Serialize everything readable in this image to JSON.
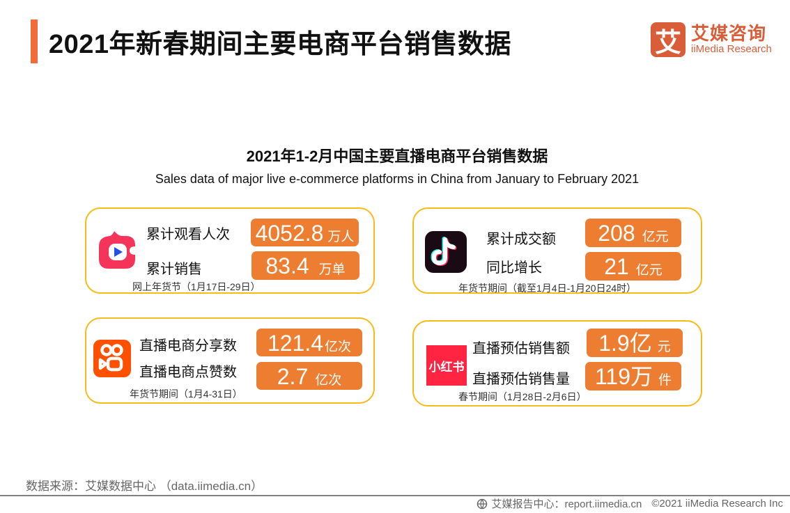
{
  "header": {
    "title": "2021年新春期间主要电商平台销售数据",
    "accent_color": "#f26b3a"
  },
  "logo": {
    "mark": "艾",
    "name_cn": "艾媒咨询",
    "name_en": "iiMedia Research",
    "color": "#d95d39"
  },
  "subtitle": {
    "cn": "2021年1-2月中国主要直播电商平台销售数据",
    "en": "Sales data of major live e-commerce platforms in China from January to February 2021"
  },
  "cards": [
    {
      "platform_icon": "taobao-live-icon",
      "rows": [
        {
          "label": "累计观看人次",
          "value": "4052.8",
          "unit": "万人"
        },
        {
          "label": "累计销售",
          "value": "83.4",
          "unit": "万单"
        }
      ],
      "note": "网上年货节（1月17日-29日）"
    },
    {
      "platform_icon": "douyin-icon",
      "rows": [
        {
          "label": "累计成交额",
          "value": "208",
          "unit": "亿元"
        },
        {
          "label": "同比增长",
          "value": "21",
          "unit": "亿元"
        }
      ],
      "note": "年货节期间（截至1月4日-1月20日24时）"
    },
    {
      "platform_icon": "kuaishou-icon",
      "rows": [
        {
          "label": "直播电商分享数",
          "value": "121.4",
          "unit": "亿次"
        },
        {
          "label": "直播电商点赞数",
          "value": "2.7",
          "unit": "亿次"
        }
      ],
      "note": "年货节期间（1月4-31日）"
    },
    {
      "platform_icon": "xiaohongshu-icon",
      "icon_text": "小红书",
      "rows": [
        {
          "label": "直播预估销售额",
          "value": "1.9亿",
          "unit": "元"
        },
        {
          "label": "直播预估销售量",
          "value": "119万",
          "unit": "件"
        }
      ],
      "note": "春节期间（1月28日-2月6日）"
    }
  ],
  "colors": {
    "card_border": "#f5bb16",
    "value_bg": "#ed7d31"
  },
  "footer": {
    "source": "数据来源：艾媒数据中心 （data.iimedia.cn）",
    "report_center": "艾媒报告中心：report.iimedia.cn",
    "copyright": "©2021  iiMedia Research  Inc"
  }
}
